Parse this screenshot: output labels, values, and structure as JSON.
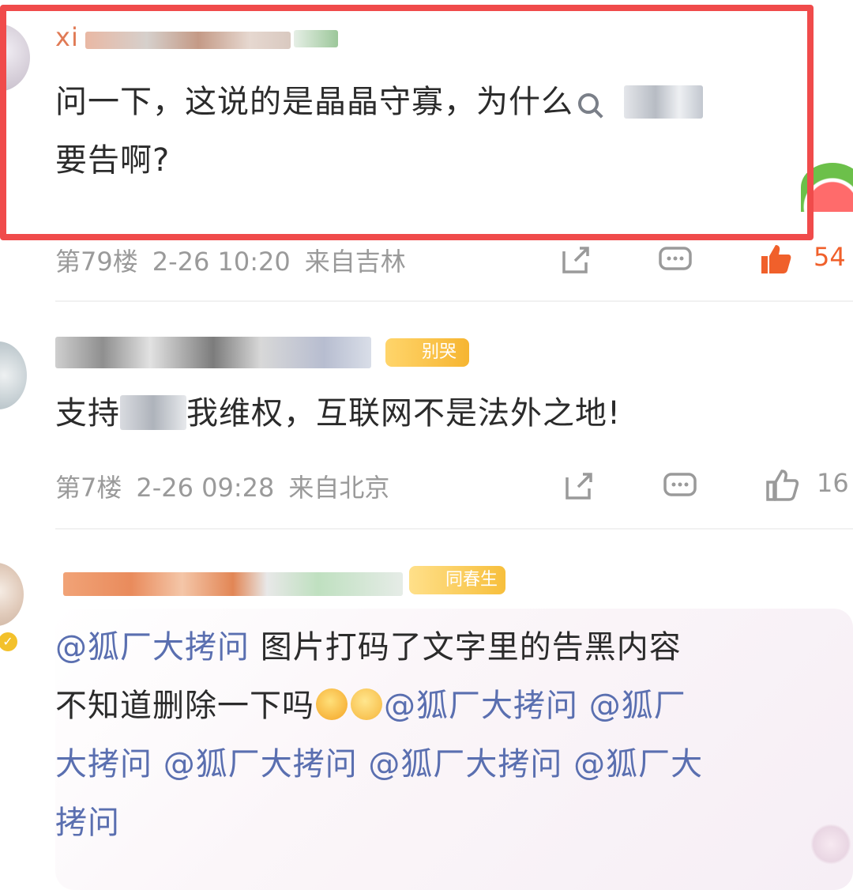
{
  "comments": [
    {
      "username_prefix": "xi",
      "text": "问一下，这说的是晶晶守寡，为什么",
      "text2": "要告啊?",
      "floor": "第79楼",
      "datetime": "2-26 10:20",
      "location": "来自吉林",
      "likes": "54"
    },
    {
      "badge_label": "别哭",
      "text": "支持",
      "text_suffix": "我维权，互联网不是法外之地!",
      "floor": "第7楼",
      "datetime": "2-26 09:28",
      "location": "来自北京",
      "likes": "16"
    },
    {
      "badge_label": "同春生",
      "mention": "@狐厂大拷问",
      "text_line1": " 图片打码了文字里的告黑内容",
      "text_line2_start": "不知道删除一下吗",
      "line2_mention": "@狐厂大拷问 @狐厂",
      "line3": "大拷问 @狐厂大拷问 @狐厂大拷问 @狐厂大",
      "line4": "拷问"
    }
  ],
  "icons": [
    "share-icon",
    "comment-icon",
    "like-icon",
    "search-icon"
  ],
  "colors": {
    "highlight": "#f04b4b",
    "liked": "#f0602b",
    "mention": "#5a6fb0",
    "meta": "#9a9a9a"
  }
}
